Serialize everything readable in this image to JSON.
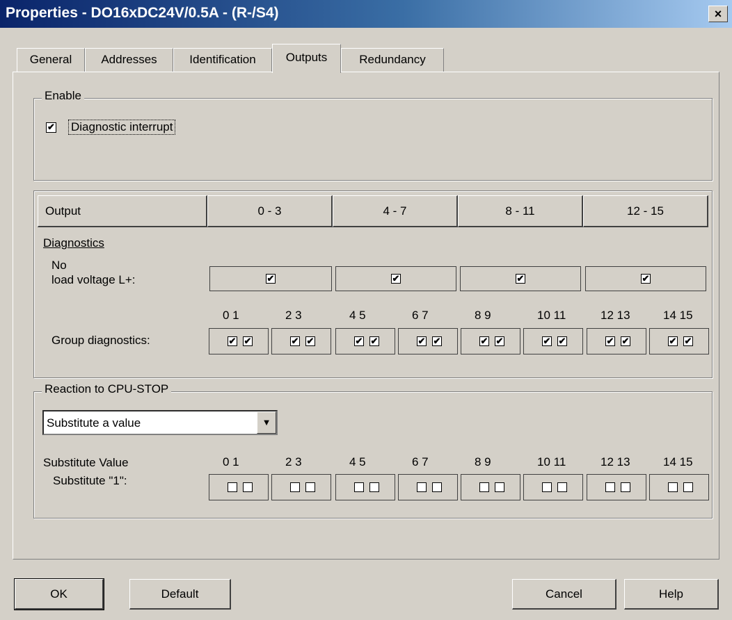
{
  "window": {
    "title": "Properties - DO16xDC24V/0.5A - (R-/S4)",
    "close_glyph": "×"
  },
  "tabs": [
    {
      "label": "General"
    },
    {
      "label": "Addresses"
    },
    {
      "label": "Identification"
    },
    {
      "label": "Outputs",
      "active": true
    },
    {
      "label": "Redundancy"
    }
  ],
  "enable": {
    "title": "Enable",
    "diagnostic_interrupt": {
      "label": "Diagnostic interrupt",
      "checked": true
    }
  },
  "output_table": {
    "header_label": "Output",
    "columns": [
      "0 - 3",
      "4 - 7",
      "8 - 11",
      "12 - 15"
    ],
    "diagnostics_label": "Diagnostics",
    "no_load_voltage": {
      "label_line1": "No",
      "label_line2": "load voltage L+:",
      "checked": [
        true,
        true,
        true,
        true
      ]
    },
    "group_diagnostics": {
      "label": "Group diagnostics:",
      "pairs": [
        "0  1",
        "2  3",
        "4  5",
        "6  7",
        "8  9",
        "10 11",
        "12 13",
        "14 15"
      ],
      "checked": [
        true,
        true,
        true,
        true,
        true,
        true,
        true,
        true,
        true,
        true,
        true,
        true,
        true,
        true,
        true,
        true
      ]
    }
  },
  "cpu_stop": {
    "title": "Reaction to CPU-STOP",
    "dropdown_value": "Substitute a value",
    "substitute_value_label": "Substitute Value",
    "substitute_one_label": "Substitute \"1\":",
    "pairs": [
      "0  1",
      "2  3",
      "4  5",
      "6  7",
      "8  9",
      "10 11",
      "12 13",
      "14 15"
    ],
    "checked": [
      false,
      false,
      false,
      false,
      false,
      false,
      false,
      false,
      false,
      false,
      false,
      false,
      false,
      false,
      false,
      false
    ]
  },
  "buttons": {
    "ok": "OK",
    "default": "Default",
    "cancel": "Cancel",
    "help": "Help"
  },
  "colors": {
    "title_start": "#0a246a",
    "title_end": "#a6caf0",
    "face": "#d4d0c8"
  }
}
